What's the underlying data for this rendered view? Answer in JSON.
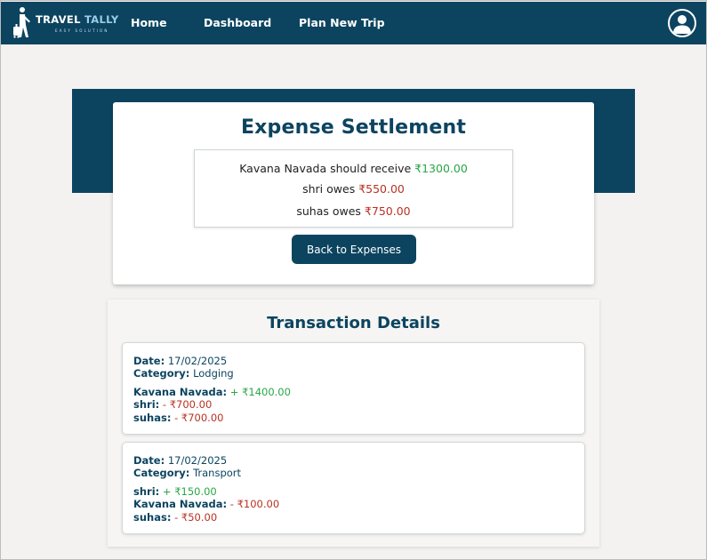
{
  "nav": {
    "logo_title_1": "TRAVEL",
    "logo_title_2": "TALLY",
    "logo_subtitle": "EASY SOLUTION",
    "links": [
      "Home",
      "Dashboard",
      "Plan New Trip"
    ],
    "profile_icon": "user-circle-icon"
  },
  "settlement": {
    "title": "Expense Settlement",
    "lines": [
      {
        "text": "Kavana Navada should receive ",
        "amount": "₹1300.00",
        "type": "receive"
      },
      {
        "text": "shri owes ",
        "amount": "₹550.00",
        "type": "owe"
      },
      {
        "text": "suhas owes ",
        "amount": "₹750.00",
        "type": "owe"
      }
    ],
    "back_button": "Back to Expenses"
  },
  "transactions": {
    "title": "Transaction Details",
    "date_label": "Date:",
    "category_label": "Category:",
    "items": [
      {
        "date": "17/02/2025",
        "category": "Lodging",
        "shares": [
          {
            "name": "Kavana Navada:",
            "amount": "+ ₹1400.00",
            "sign": "positive"
          },
          {
            "name": "shri:",
            "amount": "- ₹700.00",
            "sign": "negative"
          },
          {
            "name": "suhas:",
            "amount": "- ₹700.00",
            "sign": "negative"
          }
        ]
      },
      {
        "date": "17/02/2025",
        "category": "Transport",
        "shares": [
          {
            "name": "shri:",
            "amount": "+ ₹150.00",
            "sign": "positive"
          },
          {
            "name": "Kavana Navada:",
            "amount": "- ₹100.00",
            "sign": "negative"
          },
          {
            "name": "suhas:",
            "amount": "- ₹50.00",
            "sign": "negative"
          }
        ]
      }
    ]
  },
  "colors": {
    "primary": "#0c4460",
    "positive": "#28a745",
    "negative": "#b83224",
    "background": "#f4f2f0"
  }
}
